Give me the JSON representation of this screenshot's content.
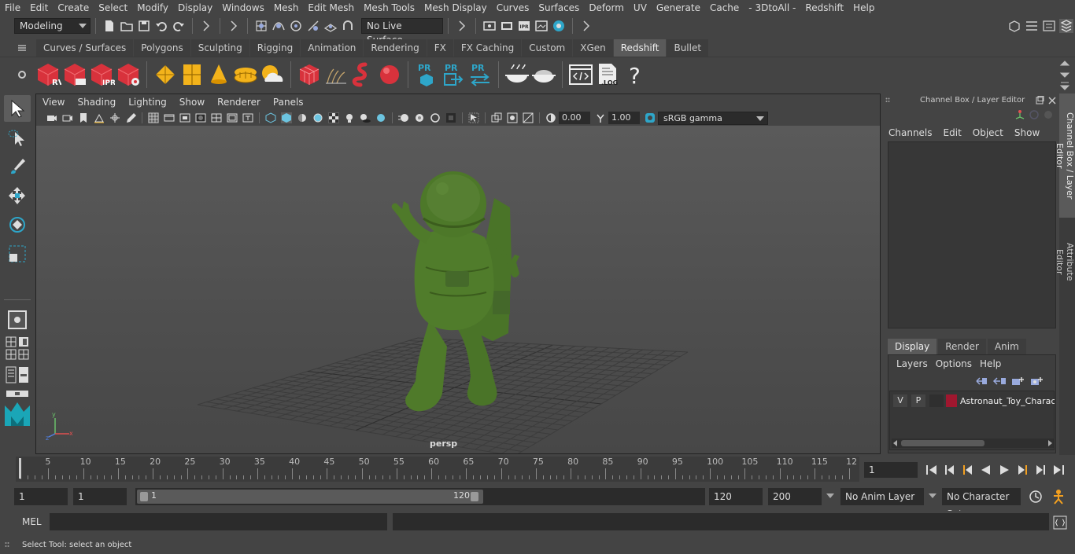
{
  "menubar": [
    "File",
    "Edit",
    "Create",
    "Select",
    "Modify",
    "Display",
    "Windows",
    "Mesh",
    "Edit Mesh",
    "Mesh Tools",
    "Mesh Display",
    "Curves",
    "Surfaces",
    "Deform",
    "UV",
    "Generate",
    "Cache",
    "- 3DtoAll -",
    "Redshift",
    "Help"
  ],
  "statusline": {
    "mode": "Modeling",
    "live_surface": "No Live Surface"
  },
  "shelf_tabs": [
    {
      "label": "Curves / Surfaces",
      "active": false
    },
    {
      "label": "Polygons",
      "active": false
    },
    {
      "label": "Sculpting",
      "active": false
    },
    {
      "label": "Rigging",
      "active": false
    },
    {
      "label": "Animation",
      "active": false
    },
    {
      "label": "Rendering",
      "active": false
    },
    {
      "label": "FX",
      "active": false
    },
    {
      "label": "FX Caching",
      "active": false
    },
    {
      "label": "Custom",
      "active": false
    },
    {
      "label": "XGen",
      "active": false
    },
    {
      "label": "Redshift",
      "active": true
    },
    {
      "label": "Bullet",
      "active": false
    }
  ],
  "shelf": {
    "rv": "RV",
    "ipr": "IPR",
    "pr": "PR",
    "log": ".LOG",
    "help": "?"
  },
  "viewport": {
    "menu": [
      "View",
      "Shading",
      "Lighting",
      "Show",
      "Renderer",
      "Panels"
    ],
    "exposure": "0.00",
    "gamma": "1.00",
    "colorspace": "sRGB gamma",
    "camera": "persp"
  },
  "channel_box": {
    "title": "Channel Box / Layer Editor",
    "menu": [
      "Channels",
      "Edit",
      "Object",
      "Show"
    ]
  },
  "layer_editor": {
    "tabs": [
      {
        "label": "Display",
        "active": true
      },
      {
        "label": "Render",
        "active": false
      },
      {
        "label": "Anim",
        "active": false
      }
    ],
    "menu": [
      "Layers",
      "Options",
      "Help"
    ],
    "layers": [
      {
        "v": "V",
        "p": "P",
        "name": "Astronaut_Toy_Charac",
        "color": "#a0172f"
      }
    ]
  },
  "side_tabs": [
    "Channel Box / Layer Editor",
    "Attribute Editor"
  ],
  "timeline": {
    "ticks": [
      "5",
      "10",
      "15",
      "20",
      "25",
      "30",
      "35",
      "40",
      "45",
      "50",
      "55",
      "60",
      "65",
      "70",
      "75",
      "80",
      "85",
      "90",
      "95",
      "100",
      "105",
      "110",
      "115",
      "12"
    ],
    "start_label": "1",
    "current_frame": "1"
  },
  "range": {
    "start": "1",
    "playback_start": "1",
    "slider_start": "1",
    "slider_end": "120",
    "playback_end": "120",
    "end": "200",
    "anim_layer": "No Anim Layer",
    "character_set": "No Character Set"
  },
  "cmdline": {
    "label": "MEL"
  },
  "helpline": {
    "text": "Select Tool: select an object"
  },
  "colors": {
    "accent": "#5a5a5a",
    "model_green": "#4f7a2a",
    "redshift_red": "#d8323c",
    "gold": "#f3b31b"
  }
}
